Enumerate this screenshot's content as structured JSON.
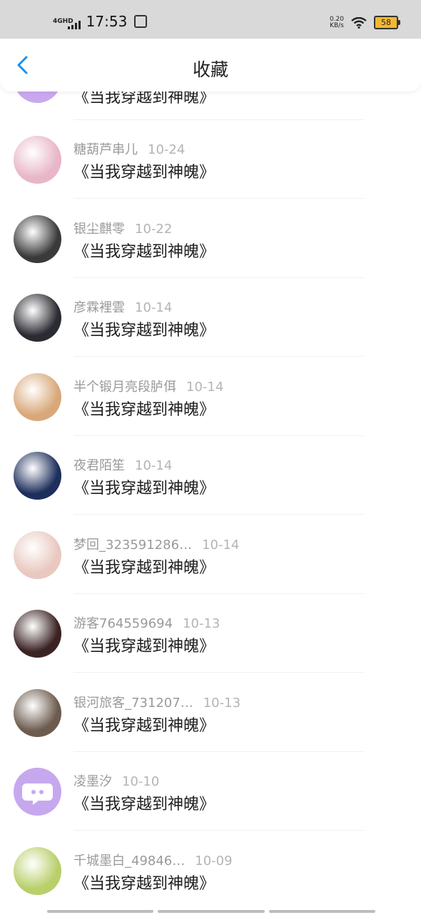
{
  "status_bar": {
    "network": "4GHD",
    "time": "17:53",
    "speed_value": "0.20",
    "speed_unit": "KB/s",
    "battery": "58"
  },
  "header": {
    "title": "收藏"
  },
  "partial_item": {
    "book": "《当我穿越到神魄》"
  },
  "items": [
    {
      "user": "糖葫芦串儿",
      "date": "10-24",
      "book": "《当我穿越到神魄》",
      "avatar_color": "#e8b6c8"
    },
    {
      "user": "银尘麒零",
      "date": "10-22",
      "book": "《当我穿越到神魄》",
      "avatar_color": "#3a3a3a"
    },
    {
      "user": "彦霖裡雲",
      "date": "10-14",
      "book": "《当我穿越到神魄》",
      "avatar_color": "#2b2b33"
    },
    {
      "user": "半个锻月亮段胪佴",
      "date": "10-14",
      "book": "《当我穿越到神魄》",
      "avatar_color": "#d9a87a"
    },
    {
      "user": "夜君陌笙",
      "date": "10-14",
      "book": "《当我穿越到神魄》",
      "avatar_color": "#1e2f5c"
    },
    {
      "user": "梦回_323591286…",
      "date": "10-14",
      "book": "《当我穿越到神魄》",
      "avatar_color": "#e9c8c0"
    },
    {
      "user": "游客764559694",
      "date": "10-13",
      "book": "《当我穿越到神魄》",
      "avatar_color": "#3b2324"
    },
    {
      "user": "银河旅客_731207…",
      "date": "10-13",
      "book": "《当我穿越到神魄》",
      "avatar_color": "#6c5b4e"
    },
    {
      "user": "凌墨汐",
      "date": "10-10",
      "book": "《当我穿越到神魄》",
      "avatar_color": "#c6a8ee"
    },
    {
      "user": "千城墨白_49846…",
      "date": "10-09",
      "book": "《当我穿越到神魄》",
      "avatar_color": "#b8cf6a"
    }
  ]
}
